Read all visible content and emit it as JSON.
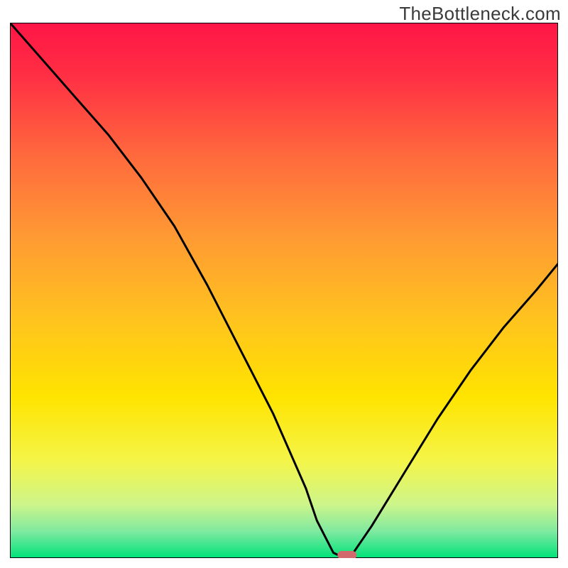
{
  "watermark": "TheBottleneck.com",
  "chart_data": {
    "type": "line",
    "title": "",
    "xlabel": "",
    "ylabel": "",
    "xlim": [
      0,
      100
    ],
    "ylim": [
      0,
      100
    ],
    "grid": false,
    "legend": false,
    "background": {
      "top_color": "#ff1546",
      "mid_color": "#ffd400",
      "bottom_color": "#00e37a",
      "description": "vertical gradient red → orange → yellow → green"
    },
    "series": [
      {
        "name": "bottleneck-curve",
        "color": "#000000",
        "x": [
          0,
          6,
          12,
          18,
          24,
          30,
          36,
          42,
          48,
          54,
          56,
          59,
          61,
          62,
          66,
          72,
          78,
          84,
          90,
          96,
          100
        ],
        "y": [
          100,
          93,
          86,
          79,
          71,
          62,
          51,
          39,
          27,
          13,
          7,
          1,
          0,
          0,
          6,
          16,
          26,
          35,
          43,
          50,
          55
        ]
      }
    ],
    "minimum_marker": {
      "x_center": 61.5,
      "width": 3.5,
      "color": "#d26a6d"
    }
  }
}
